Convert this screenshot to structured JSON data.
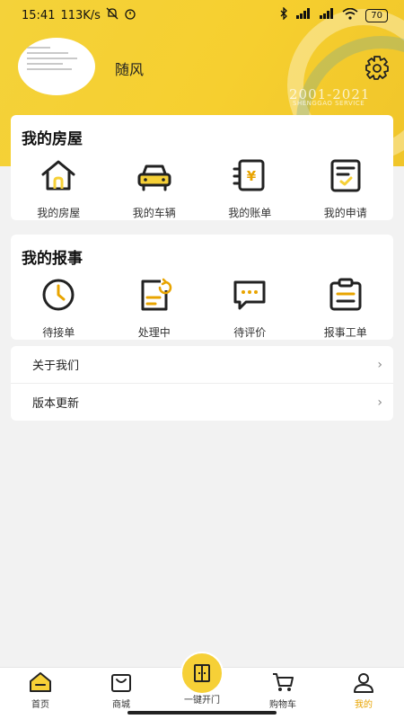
{
  "status": {
    "time": "15:41",
    "speed": "113K/s",
    "battery": "70"
  },
  "header": {
    "username": "随风",
    "watermark_years": "2001-2021",
    "watermark_text": "SHENGGAO SERVICE"
  },
  "house": {
    "title": "我的房屋",
    "items": [
      {
        "label": "我的房屋",
        "icon": "house-icon"
      },
      {
        "label": "我的车辆",
        "icon": "car-icon"
      },
      {
        "label": "我的账单",
        "icon": "bill-icon"
      },
      {
        "label": "我的申请",
        "icon": "application-icon"
      }
    ]
  },
  "report": {
    "title": "我的报事",
    "items": [
      {
        "label": "待接单",
        "icon": "clock-icon"
      },
      {
        "label": "处理中",
        "icon": "processing-icon"
      },
      {
        "label": "待评价",
        "icon": "comment-icon"
      },
      {
        "label": "报事工单",
        "icon": "clipboard-icon"
      }
    ]
  },
  "list": {
    "about": "关于我们",
    "update": "版本更新"
  },
  "tabbar": {
    "home": "首页",
    "mall": "商城",
    "open": "一键开门",
    "cart": "购物车",
    "mine": "我的"
  },
  "colors": {
    "accent": "#f6d037",
    "active_tab": "#e8a400"
  }
}
